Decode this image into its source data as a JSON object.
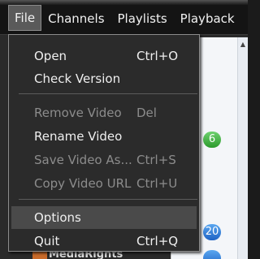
{
  "menubar": {
    "items": [
      {
        "label": "File"
      },
      {
        "label": "Channels"
      },
      {
        "label": "Playlists"
      },
      {
        "label": "Playback"
      }
    ]
  },
  "file_menu": {
    "items": [
      {
        "label": "Open",
        "shortcut": "Ctrl+O",
        "enabled": true
      },
      {
        "label": "Check Version",
        "shortcut": "",
        "enabled": true
      },
      {
        "label": "Remove Video",
        "shortcut": "Del",
        "enabled": false
      },
      {
        "label": "Rename Video",
        "shortcut": "",
        "enabled": true
      },
      {
        "label": "Save Video As...",
        "shortcut": "Ctrl+S",
        "enabled": false
      },
      {
        "label": "Copy Video URL",
        "shortcut": "Ctrl+U",
        "enabled": false
      },
      {
        "label": "Options",
        "shortcut": "",
        "enabled": true,
        "highlighted": true
      },
      {
        "label": "Quit",
        "shortcut": "Ctrl+Q",
        "enabled": true
      }
    ]
  },
  "background": {
    "badges": [
      {
        "value": "6",
        "color": "#2c9a2c"
      },
      {
        "value": "20",
        "color": "#1e63c4"
      }
    ],
    "partial_label": "MediaRights"
  }
}
